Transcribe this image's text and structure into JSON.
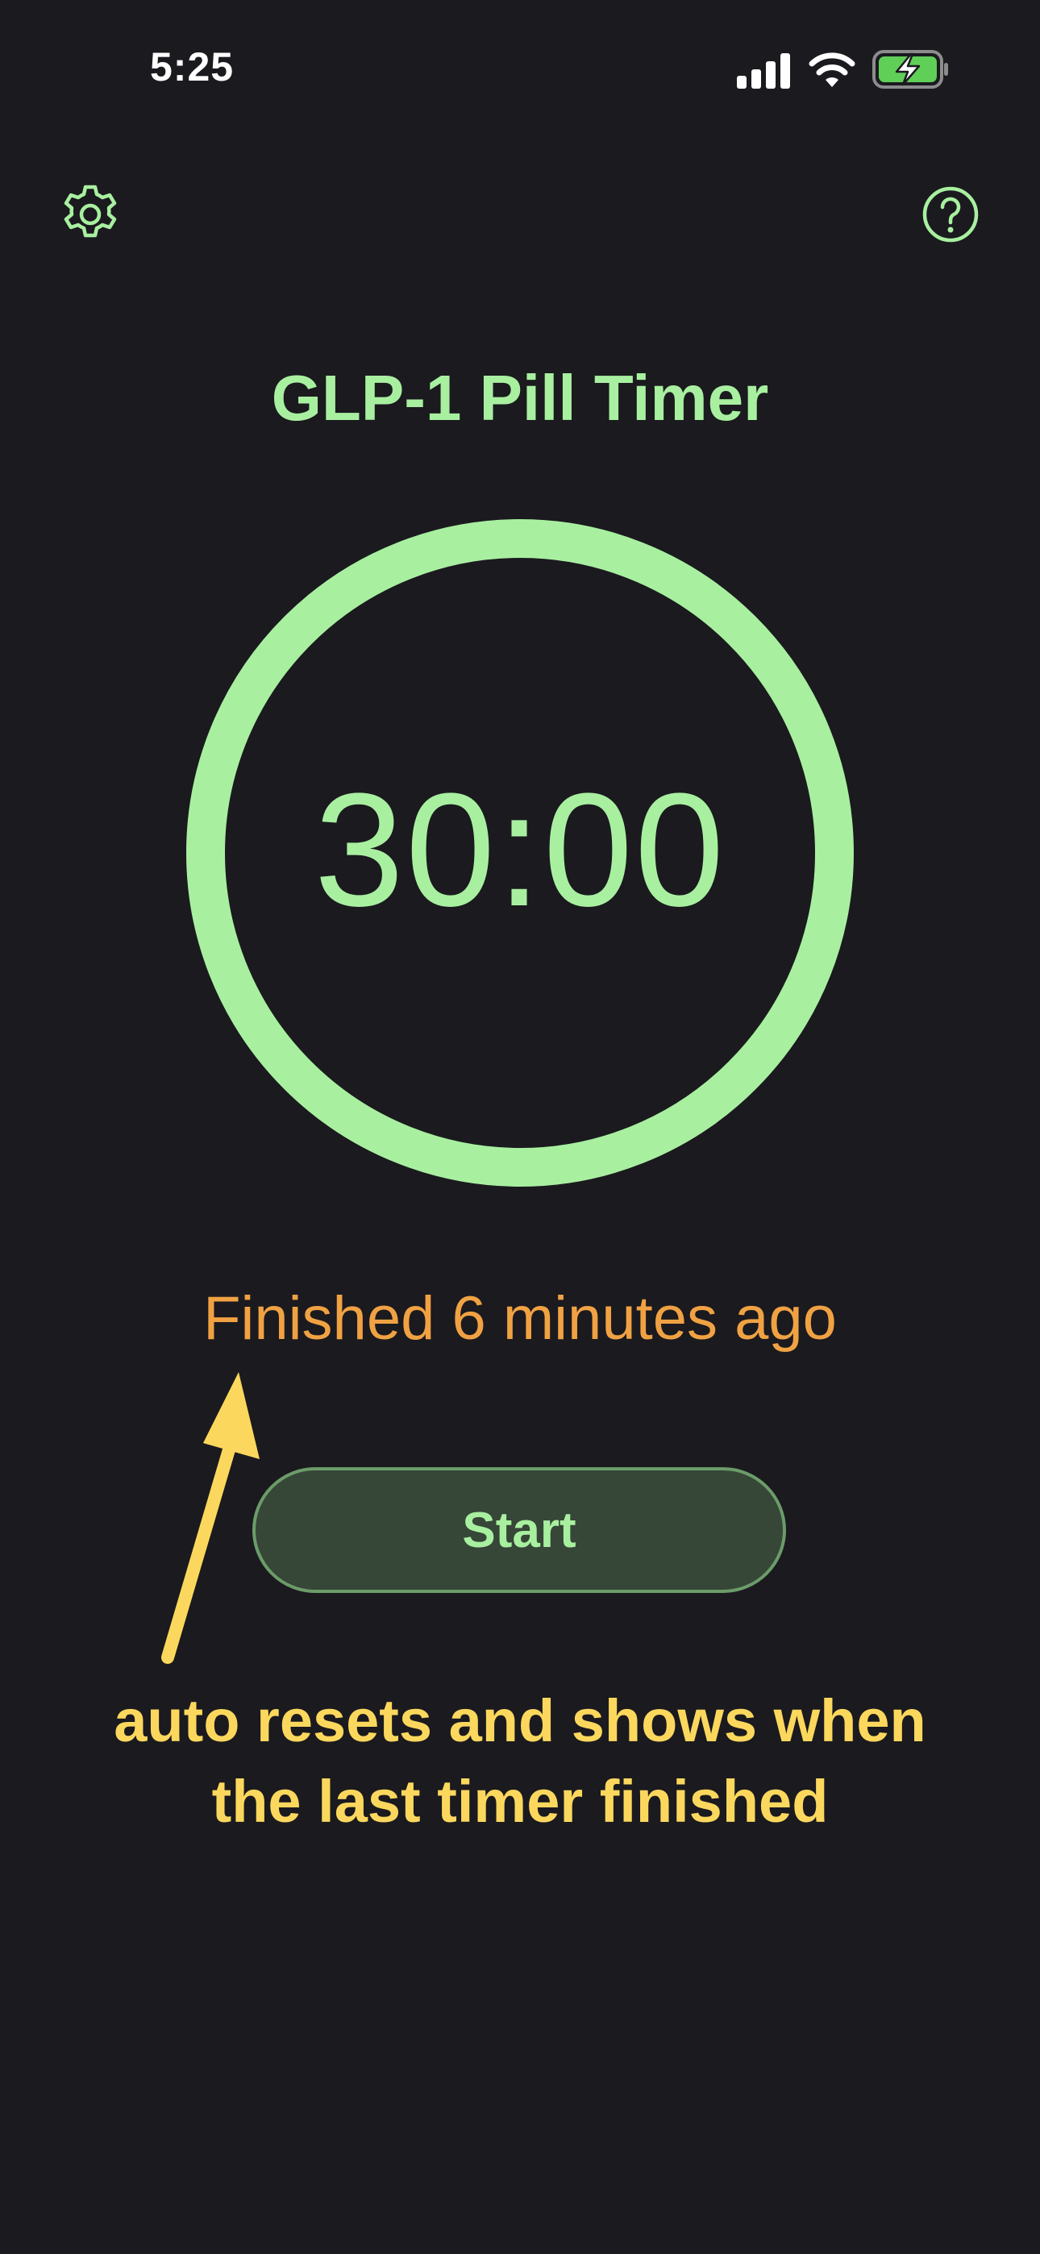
{
  "status_bar": {
    "time": "5:25",
    "icons": [
      "cellular-signal-icon",
      "wifi-icon",
      "battery-charging-icon"
    ]
  },
  "toolbar": {
    "settings_icon": "gear-icon",
    "help_icon": "question-mark-circle-icon"
  },
  "app": {
    "title": "GLP-1 Pill Timer"
  },
  "timer": {
    "display": "30:00",
    "progress": 1.0
  },
  "status": {
    "finished_text": "Finished 6 minutes ago"
  },
  "controls": {
    "start_label": "Start"
  },
  "annotation": {
    "line1": "auto resets and shows when",
    "line2": "the last timer finished"
  },
  "colors": {
    "background": "#1b1a1f",
    "accent_green": "#a8f0a0",
    "button_fill": "#364637",
    "button_border": "#6b9c69",
    "finished_orange": "#f0a243",
    "annotation_yellow": "#fbd85d",
    "battery_green": "#5fcf58"
  }
}
